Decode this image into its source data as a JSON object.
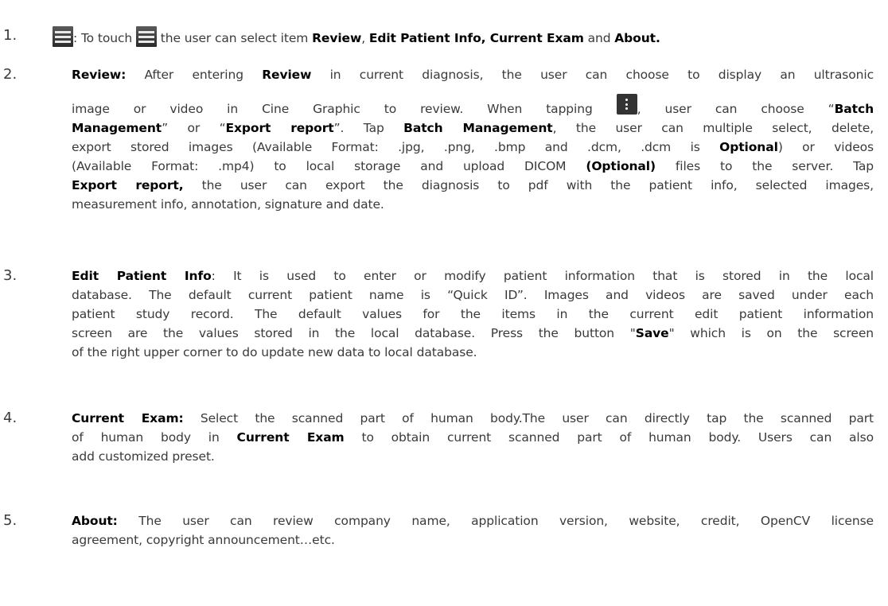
{
  "items": [
    {
      "number": "1.",
      "intro_1": ": To touch ",
      "intro_2": " the user can select item ",
      "review": "Review",
      "comma": ", ",
      "edit_current": "Edit Patient Info, Current Exam",
      "and": " and ",
      "about": "About."
    },
    {
      "number": "2.",
      "label": "Review:",
      "t1": " After entering ",
      "review": "Review",
      "t2": " in current diagnosis, the user can choose to display an ultrasonic",
      "t3": "image or video in Cine Graphic to review. When tapping ",
      "t4": ", user can choose “",
      "batch": "Batch",
      "management": "Management",
      "t5": "” or “",
      "export_report": "Export report",
      "t6": "”. Tap ",
      "batch_management": "Batch Management",
      "t7": ", the user can multiple select, delete,",
      "t8": "export stored images (Available Format: .jpg, .png, .bmp and .dcm, .dcm is ",
      "optional": "Optional",
      "t9": ") or videos",
      "t10": "(Available Format: .mp4) to local storage and upload DICOM ",
      "optional_paren": "(Optional)",
      "t11": " files to the server. Tap",
      "export_report_comma": "Export report,",
      "t12": " the user can export the diagnosis to pdf with the patient info, selected images,",
      "t13": "measurement info, annotation, signature and date."
    },
    {
      "number": "3.",
      "label": "Edit Patient Info",
      "t1": ": It is used to enter or modify patient information that is stored in the local",
      "t2": "database. The default current patient name is “Quick ID”. Images and videos are saved under each",
      "t3": "patient study record. The default values for the items in the current edit patient information",
      "t4": "screen are the values stored in the local database. Press the button \"",
      "save": "Save",
      "t5": "\" which is on the screen",
      "t6": "of the right upper corner to do update new data to local database."
    },
    {
      "number": "4.",
      "label": "Current Exam:",
      "t1": " Select the scanned part of human body.The user can directly tap the scanned part",
      "t2": "of human body in ",
      "current_exam": "Current Exam",
      "t3": " to obtain current scanned part of human body. Users can also",
      "t4": "add customized preset."
    },
    {
      "number": "5.",
      "label": "About:",
      "t1": " The user can review company name, application version, website, credit, OpenCV license",
      "t2": "agreement, copyright announcement…etc."
    }
  ]
}
